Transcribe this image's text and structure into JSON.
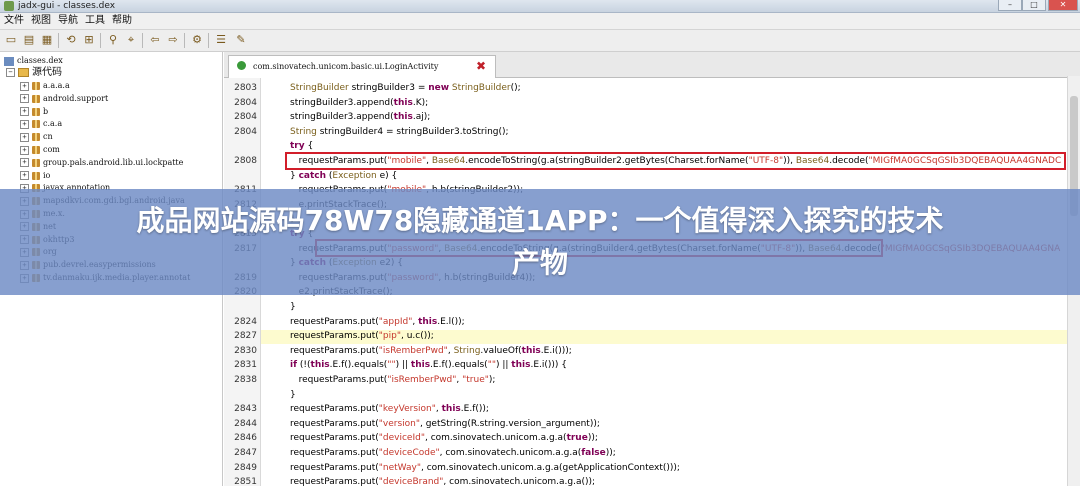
{
  "window": {
    "title": "jadx-gui - classes.dex",
    "minimize": "–",
    "maximize": "□",
    "close": "✕"
  },
  "menu": [
    "文件",
    "视图",
    "导航",
    "工具",
    "帮助"
  ],
  "toolbar": {
    "icons": [
      "open-icon",
      "save-icon",
      "save-all-icon",
      "sync-icon",
      "tree-icon",
      "find-icon",
      "find-class-icon",
      "back-icon",
      "forward-icon",
      "decompile-icon",
      "log-icon",
      "settings-icon"
    ],
    "glyphs": [
      "▭",
      "▤",
      "▦",
      "⟲",
      "⊞",
      "⚲",
      "⌖",
      "⇦",
      "⇨",
      "⚙",
      "☰",
      "✎"
    ]
  },
  "tree": {
    "root": "classes.dex",
    "source_folder": "源代码",
    "packages": [
      "a.a.a.a",
      "android.support",
      "b",
      "c.a.a",
      "cn",
      "com",
      "group.pals.android.lib.ui.lockpatte",
      "io",
      "javax.annotation",
      "mapsdkvi.com.gdi.bgl.android.java",
      "me.x.",
      "net",
      "okhttp3",
      "org",
      "pub.devrel.easypermissions",
      "tv.danmaku.ijk.media.player.annotat"
    ]
  },
  "editor": {
    "tab_label": "com.sinovatech.unicom.basic.ui.LoginActivity",
    "lines": [
      {
        "n": "2803",
        "html": "<span class='cls'>StringBuilder</span> stringBuilder3 = <span class='kw'>new</span> <span class='cls'>StringBuilder</span>();"
      },
      {
        "n": "2804",
        "html": "stringBuilder3.append(<span class='kw'>this</span>.K);"
      },
      {
        "n": "2804",
        "html": "stringBuilder3.append(<span class='kw'>this</span>.aj);"
      },
      {
        "n": "2804",
        "html": "<span class='cls'>String</span> stringBuilder4 = stringBuilder3.toString();"
      },
      {
        "n": "",
        "html": "<span class='kw'>try</span> {"
      },
      {
        "n": "2808",
        "html": "&nbsp;&nbsp;&nbsp;requestParams.put(<span class='str'>\"mobile\"</span>, <span class='cls'>Base64</span>.encodeToString(g.a(stringBuilder2.getBytes(Charset.forName(<span class='str'>\"UTF-8\"</span>)), <span class='cls'>Base64</span>.decode(<span class='str'>\"MIGfMA0GCSqGSIb3DQEBAQUAA4GNADC</span>"
      },
      {
        "n": "",
        "html": "} <span class='kw'>catch</span> (<span class='cls'>Exception</span> e) {"
      },
      {
        "n": "2811",
        "html": "&nbsp;&nbsp;&nbsp;requestParams.put(<span class='str'>\"mobile\"</span>, h.b(stringBuilder2));"
      },
      {
        "n": "2812",
        "html": "&nbsp;&nbsp;&nbsp;e.printStackTrace();"
      },
      {
        "n": "",
        "html": "}"
      },
      {
        "n": "2815",
        "html": "<span class='kw'>try</span> {"
      },
      {
        "n": "2817",
        "html": "&nbsp;&nbsp;&nbsp;requestParams.put(<span class='str'>\"password\"</span>, <span class='cls'>Base64</span>.encodeToString(g.a(stringBuilder4.getBytes(Charset.forName(<span class='str'>\"UTF-8\"</span>)), <span class='cls'>Base64</span>.decode(<span class='str'>\"MIGfMA0GCSqGSIb3DQEBAQUAA4GNA</span>"
      },
      {
        "n": "",
        "html": "} <span class='kw'>catch</span> (<span class='cls'>Exception</span> e2) {"
      },
      {
        "n": "2819",
        "html": "&nbsp;&nbsp;&nbsp;requestParams.put(<span class='str'>\"password\"</span>, h.b(stringBuilder4));"
      },
      {
        "n": "2820",
        "html": "&nbsp;&nbsp;&nbsp;e2.printStackTrace();"
      },
      {
        "n": "",
        "html": "}"
      },
      {
        "n": "2824",
        "html": "requestParams.put(<span class='str'>\"appId\"</span>, <span class='kw'>this</span>.E.l());"
      },
      {
        "n": "2827",
        "html": "requestParams.put(<span class='str'>\"pip\"</span>, u.c());"
      },
      {
        "n": "2830",
        "html": "requestParams.put(<span class='str'>\"isRemberPwd\"</span>, <span class='cls'>String</span>.valueOf(<span class='kw'>this</span>.E.i()));"
      },
      {
        "n": "2831",
        "html": "<span class='kw'>if</span> (!(<span class='kw'>this</span>.E.f().equals(<span class='str'>\"\"</span>) || <span class='kw'>this</span>.E.f().equals(<span class='str'>\"\"</span>) || <span class='kw'>this</span>.E.i())) {"
      },
      {
        "n": "2838",
        "html": "&nbsp;&nbsp;&nbsp;requestParams.put(<span class='str'>\"isRemberPwd\"</span>, <span class='str'>\"true\"</span>);"
      },
      {
        "n": "",
        "html": "}"
      },
      {
        "n": "2843",
        "html": "requestParams.put(<span class='str'>\"keyVersion\"</span>, <span class='kw'>this</span>.E.f());"
      },
      {
        "n": "2844",
        "html": "requestParams.put(<span class='str'>\"version\"</span>, getString(R.string.version_argument));"
      },
      {
        "n": "2846",
        "html": "requestParams.put(<span class='str'>\"deviceId\"</span>, com.sinovatech.unicom.a.g.a(<span class='kw'>true</span>));"
      },
      {
        "n": "2847",
        "html": "requestParams.put(<span class='str'>\"deviceCode\"</span>, com.sinovatech.unicom.a.g.a(<span class='kw'>false</span>));"
      },
      {
        "n": "2849",
        "html": "requestParams.put(<span class='str'>\"netWay\"</span>, com.sinovatech.unicom.a.g.a(getApplicationContext()));"
      },
      {
        "n": "2851",
        "html": "requestParams.put(<span class='str'>\"deviceBrand\"</span>, com.sinovatech.unicom.a.g.a());"
      }
    ]
  },
  "banner": {
    "line1": "成品网站源码78W78隐藏通道1APP：一个值得深入探究的技术",
    "line2": "产物"
  },
  "colors": {
    "keyword": "#7f0055",
    "string": "#c4372c",
    "highlight": "#fdfbcf",
    "box": "#d21e2a",
    "banner": "#6c8ac4"
  }
}
